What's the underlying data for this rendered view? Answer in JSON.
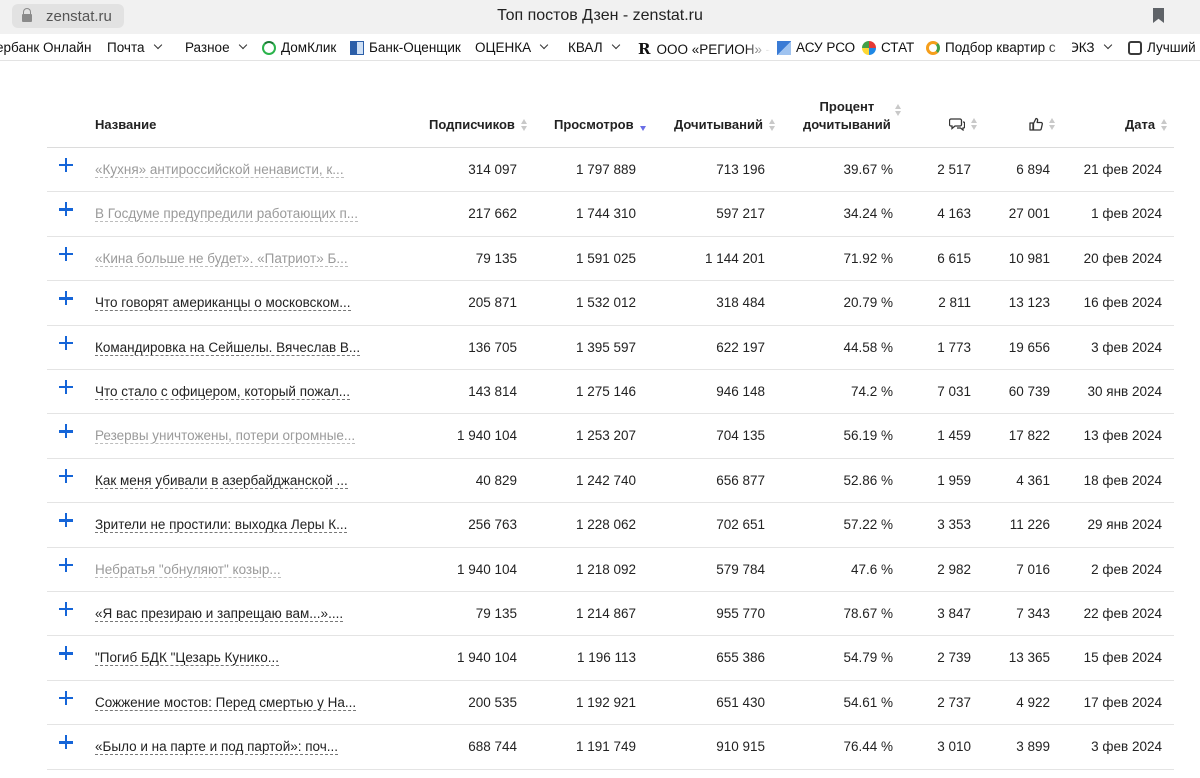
{
  "browser": {
    "url": "zenstat.ru",
    "window_title": "Топ постов Дзен - zenstat.ru"
  },
  "bookmarks": [
    {
      "label": "ербанк Онлайн",
      "icon": null,
      "dropdown": false
    },
    {
      "label": "Почта",
      "icon": null,
      "dropdown": true
    },
    {
      "label": "Разное",
      "icon": null,
      "dropdown": true
    },
    {
      "label": "ДомКлик",
      "icon": "domclick-icon",
      "dropdown": false
    },
    {
      "label": "Банк-Оценщик",
      "icon": "bank-icon",
      "dropdown": false
    },
    {
      "label": "ОЦЕНКА",
      "icon": null,
      "dropdown": true
    },
    {
      "label": "КВАЛ",
      "icon": null,
      "dropdown": true
    },
    {
      "label": "ООО «РЕГИОН» -",
      "icon": "r-letter-icon",
      "dropdown": false
    },
    {
      "label": "АСУ РСО",
      "icon": "asu-icon",
      "dropdown": false
    },
    {
      "label": "СТАТ",
      "icon": "stat-icon",
      "dropdown": false
    },
    {
      "label": "Подбор квартир с",
      "icon": "podbor-icon",
      "dropdown": false
    },
    {
      "label": "ЭКЗ",
      "icon": null,
      "dropdown": true
    },
    {
      "label": "Лучший",
      "icon": "best-icon",
      "dropdown": false
    }
  ],
  "table": {
    "headers": {
      "name": "Название",
      "subscribers": "Подписчиков",
      "views": "Просмотров",
      "reads": "Дочитываний",
      "percent_line1": "Процент",
      "percent_line2": "дочитываний",
      "comments_icon": "comment-icon",
      "likes_icon": "like-icon",
      "date": "Дата"
    },
    "sorted_by": "views",
    "accent_color": "#1565d8",
    "rows": [
      {
        "name": "«Кухня» антироссийской ненависти, к...",
        "muted": true,
        "subscribers": "314 097",
        "views": "1 797 889",
        "reads": "713 196",
        "percent": "39.67 %",
        "comments": "2 517",
        "likes": "6 894",
        "date": "21 фев 2024"
      },
      {
        "name": "В Госдуме предупредили работающих п...",
        "muted": true,
        "subscribers": "217 662",
        "views": "1 744 310",
        "reads": "597 217",
        "percent": "34.24 %",
        "comments": "4 163",
        "likes": "27 001",
        "date": "1 фев 2024"
      },
      {
        "name": "«Кина больше не будет». «Патриот» Б...",
        "muted": true,
        "subscribers": "79 135",
        "views": "1 591 025",
        "reads": "1 144 201",
        "percent": "71.92 %",
        "comments": "6 615",
        "likes": "10 981",
        "date": "20 фев 2024"
      },
      {
        "name": "Что говорят американцы о московском...",
        "muted": false,
        "subscribers": "205 871",
        "views": "1 532 012",
        "reads": "318 484",
        "percent": "20.79 %",
        "comments": "2 811",
        "likes": "13 123",
        "date": "16 фев 2024"
      },
      {
        "name": "Командировка на Сейшелы. Вячеслав В...",
        "muted": false,
        "subscribers": "136 705",
        "views": "1 395 597",
        "reads": "622 197",
        "percent": "44.58 %",
        "comments": "1 773",
        "likes": "19 656",
        "date": "3 фев 2024"
      },
      {
        "name": "Что стало с офицером, который пожал...",
        "muted": false,
        "subscribers": "143 814",
        "views": "1 275 146",
        "reads": "946 148",
        "percent": "74.2 %",
        "comments": "7 031",
        "likes": "60 739",
        "date": "30 янв 2024"
      },
      {
        "name": "Резервы уничтожены, потери огромные...",
        "muted": true,
        "subscribers": "1 940 104",
        "views": "1 253 207",
        "reads": "704 135",
        "percent": "56.19 %",
        "comments": "1 459",
        "likes": "17 822",
        "date": "13 фев 2024"
      },
      {
        "name": "Как меня убивали в азербайджанской ...",
        "muted": false,
        "subscribers": "40 829",
        "views": "1 242 740",
        "reads": "656 877",
        "percent": "52.86 %",
        "comments": "1 959",
        "likes": "4 361",
        "date": "18 фев 2024"
      },
      {
        "name": "Зрители не простили: выходка Леры К...",
        "muted": false,
        "subscribers": "256 763",
        "views": "1 228 062",
        "reads": "702 651",
        "percent": "57.22 %",
        "comments": "3 353",
        "likes": "11 226",
        "date": "29 янв 2024"
      },
      {
        "name": "Небратья \"обнуляют\" козыр...",
        "muted": true,
        "subscribers": "1 940 104",
        "views": "1 218 092",
        "reads": "579 784",
        "percent": "47.6 %",
        "comments": "2 982",
        "likes": "7 016",
        "date": "2 фев 2024"
      },
      {
        "name": "«Я вас презираю и запрещаю вам...»....",
        "muted": false,
        "subscribers": "79 135",
        "views": "1 214 867",
        "reads": "955 770",
        "percent": "78.67 %",
        "comments": "3 847",
        "likes": "7 343",
        "date": "22 фев 2024"
      },
      {
        "name": "\"Погиб БДК \"Цезарь Кунико...",
        "muted": false,
        "subscribers": "1 940 104",
        "views": "1 196 113",
        "reads": "655 386",
        "percent": "54.79 %",
        "comments": "2 739",
        "likes": "13 365",
        "date": "15 фев 2024"
      },
      {
        "name": "Сожжение мостов: Перед смертью у На...",
        "muted": false,
        "subscribers": "200 535",
        "views": "1 192 921",
        "reads": "651 430",
        "percent": "54.61 %",
        "comments": "2 737",
        "likes": "4 922",
        "date": "17 фев 2024"
      },
      {
        "name": "«Было и на парте и под партой»: поч...",
        "muted": false,
        "subscribers": "688 744",
        "views": "1 191 749",
        "reads": "910 915",
        "percent": "76.44 %",
        "comments": "3 010",
        "likes": "3 899",
        "date": "3 фев 2024"
      }
    ]
  }
}
